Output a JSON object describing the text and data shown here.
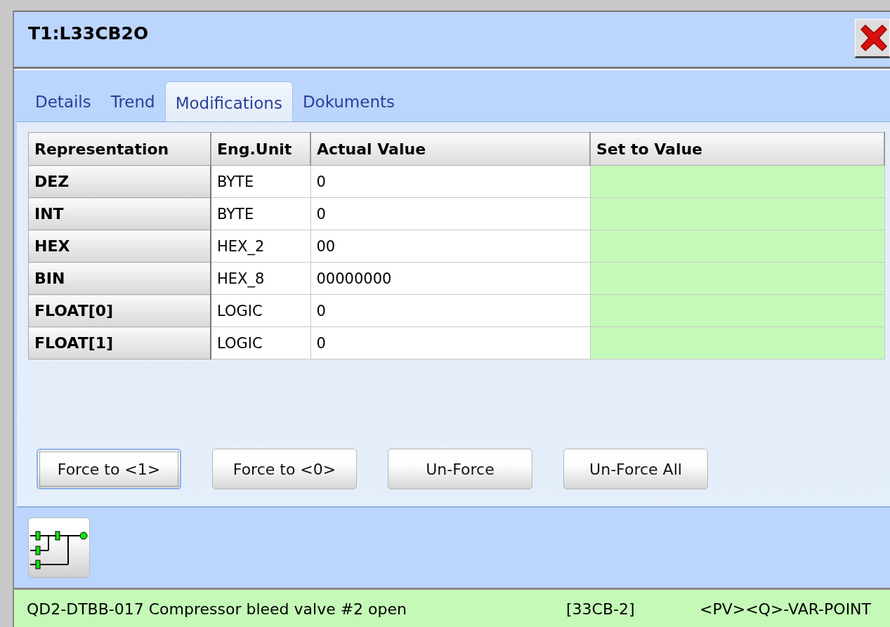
{
  "window": {
    "title": "T1:L33CB2O"
  },
  "tabs": [
    {
      "label": "Details",
      "selected": false
    },
    {
      "label": "Trend",
      "selected": false
    },
    {
      "label": "Modifications",
      "selected": true
    },
    {
      "label": "Dokuments",
      "selected": false
    }
  ],
  "table": {
    "columns": [
      "Representation",
      "Eng.Unit",
      "Actual Value",
      "Set to Value"
    ],
    "rows": [
      {
        "representation": "DEZ",
        "unit": "BYTE",
        "actual": "0"
      },
      {
        "representation": "INT",
        "unit": "BYTE",
        "actual": "0"
      },
      {
        "representation": "HEX",
        "unit": "HEX_2",
        "actual": "00"
      },
      {
        "representation": "BIN",
        "unit": "HEX_8",
        "actual": "00000000"
      },
      {
        "representation": "FLOAT[0]",
        "unit": "LOGIC",
        "actual": "0"
      },
      {
        "representation": "FLOAT[1]",
        "unit": "LOGIC",
        "actual": "0"
      }
    ]
  },
  "buttons": [
    {
      "label": "Force to <1>",
      "focused": true
    },
    {
      "label": "Force to <0>",
      "focused": false
    },
    {
      "label": "Un-Force",
      "focused": false
    },
    {
      "label": "Un-Force All",
      "focused": false
    }
  ],
  "status_bar": {
    "description": "QD2-DTBB-017 Compressor bleed valve #2 open",
    "tag": "[33CB-2]",
    "type": "<PV><Q>-VAR-POINT"
  }
}
